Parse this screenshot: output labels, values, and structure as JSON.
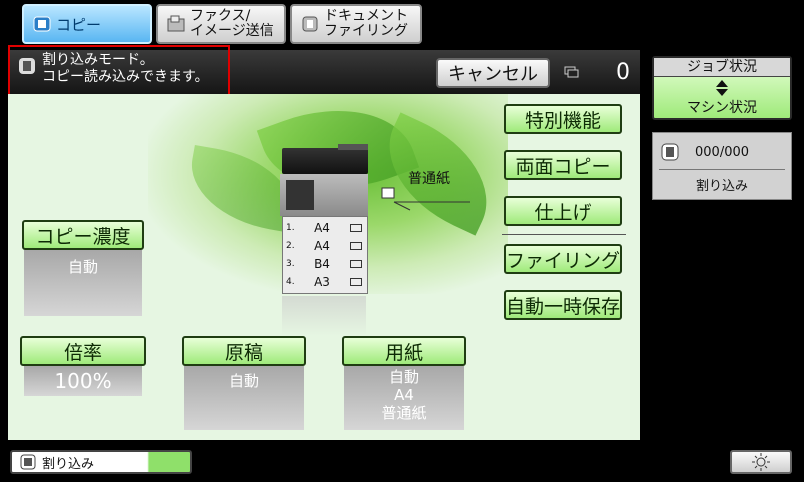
{
  "tabs": [
    {
      "label": "コピー"
    },
    {
      "label_line1": "ファクス/",
      "label_line2": "イメージ送信"
    },
    {
      "label_line1": "ドキュメント",
      "label_line2": "ファイリング"
    }
  ],
  "message": {
    "line1": "割り込みモード。",
    "line2": "コピー読み込みできます。"
  },
  "cancel_label": "キャンセル",
  "copy_count": "0",
  "right_buttons": [
    "特別機能",
    "両面コピー",
    "仕上げ",
    "ファイリング",
    "自動一時保存"
  ],
  "settings": {
    "density": {
      "label": "コピー濃度",
      "value": "自動"
    },
    "ratio": {
      "label": "倍率",
      "value": "100%"
    },
    "original": {
      "label": "原稿",
      "value": "自動"
    },
    "paper": {
      "label": "用紙",
      "value_line1": "自動",
      "value_line2": "A4",
      "value_line3": "普通紙"
    }
  },
  "machine": {
    "bypass_label": "普通紙",
    "trays": [
      {
        "num": "1.",
        "size": "A4"
      },
      {
        "num": "2.",
        "size": "A4"
      },
      {
        "num": "3.",
        "size": "B4"
      },
      {
        "num": "4.",
        "size": "A3"
      }
    ]
  },
  "job_status": {
    "line1": "ジョブ状況",
    "line2": "マシン状況"
  },
  "queue": {
    "count": "000/000",
    "label": "割り込み"
  },
  "bottom": {
    "interrupt_label": "割り込み"
  }
}
